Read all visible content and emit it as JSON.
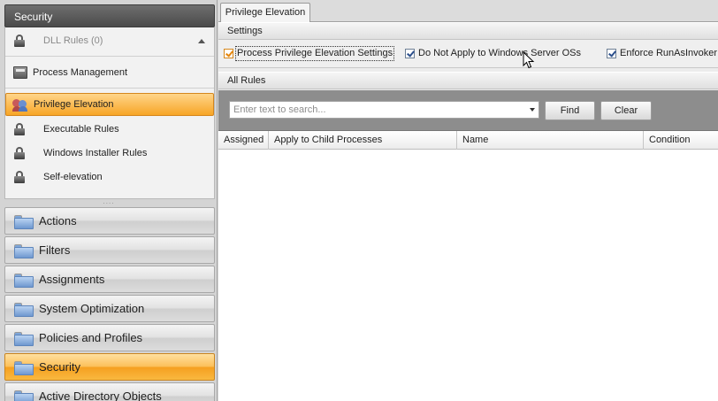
{
  "sidebar": {
    "header": "Security",
    "tree": [
      {
        "label": "DLL Rules (0)",
        "icon": "lock-icon",
        "disabled": true
      },
      {
        "label": "Process Management",
        "icon": "process-management-icon"
      },
      {
        "label": "Privilege Elevation",
        "icon": "users-icon",
        "selected": true
      },
      {
        "label": "Executable Rules",
        "icon": "lock-icon"
      },
      {
        "label": "Windows Installer Rules",
        "icon": "lock-icon"
      },
      {
        "label": "Self-elevation",
        "icon": "lock-icon"
      }
    ],
    "grip": "....",
    "nav": [
      {
        "label": "Actions",
        "icon": "folder-icon"
      },
      {
        "label": "Filters",
        "icon": "folder-icon"
      },
      {
        "label": "Assignments",
        "icon": "folder-icon"
      },
      {
        "label": "System Optimization",
        "icon": "folder-icon"
      },
      {
        "label": "Policies and Profiles",
        "icon": "folder-icon"
      },
      {
        "label": "Security",
        "icon": "folder-icon",
        "selected": true
      },
      {
        "label": "Active Directory Objects",
        "icon": "folder-icon"
      }
    ]
  },
  "main": {
    "tab": "Privilege Elevation",
    "settings": {
      "title": "Settings",
      "checkboxes": [
        {
          "label": "Process Privilege Elevation Settings",
          "checked": true
        },
        {
          "label": "Do Not Apply to Windows Server OSs",
          "checked": true
        },
        {
          "label": "Enforce RunAsInvoker",
          "checked": true
        }
      ]
    },
    "rules": {
      "title": "All Rules",
      "search_placeholder": "Enter text to search...",
      "find_label": "Find",
      "clear_label": "Clear",
      "columns": [
        "Assigned",
        "Apply to Child Processes",
        "Name",
        "Condition"
      ],
      "rows": []
    }
  },
  "colors": {
    "selected_accent": "#f7a526",
    "header_dark": "#4b4b4b",
    "search_bar": "#8d8d8d"
  }
}
